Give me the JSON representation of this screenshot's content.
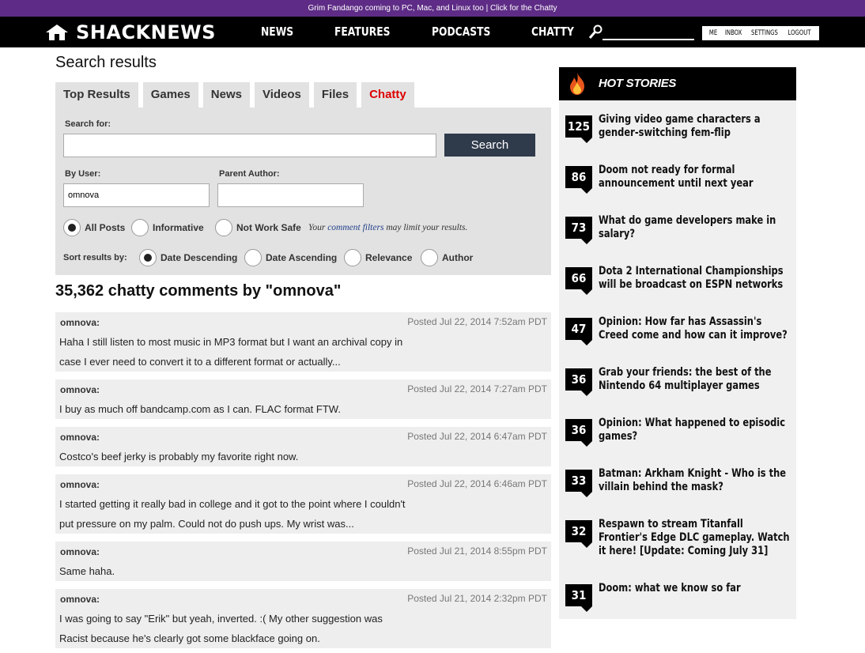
{
  "banner": {
    "text": "Grim Fandango coming to PC, Mac, and Linux too",
    "link": "Click for the Chatty"
  },
  "brand": {
    "name": "SHACKNEWS"
  },
  "nav": [
    "NEWS",
    "FEATURES",
    "PODCASTS",
    "CHATTY"
  ],
  "user_menu": [
    "ME",
    "INBOX",
    "SETTINGS",
    "LOGOUT"
  ],
  "page_title": "Search results",
  "tabs": [
    "Top Results",
    "Games",
    "News",
    "Videos",
    "Files",
    "Chatty"
  ],
  "active_tab": "Chatty",
  "search": {
    "search_for_label": "Search for:",
    "search_for_value": "",
    "button": "Search",
    "by_user_label": "By User:",
    "by_user_value": "omnova",
    "parent_author_label": "Parent Author:",
    "parent_author_value": "",
    "filters": [
      "All Posts",
      "Informative",
      "Not Work Safe"
    ],
    "filter_selected": "All Posts",
    "note_before": "Your",
    "note_link": "comment filters",
    "note_after": "may limit your results.",
    "sort_label": "Sort results by:",
    "sort_options": [
      "Date Descending",
      "Date Ascending",
      "Relevance",
      "Author"
    ],
    "sort_selected": "Date Descending"
  },
  "results_heading": "35,362 chatty comments by \"omnova\"",
  "results": [
    {
      "author": "omnova:",
      "date": "Posted Jul 22, 2014 7:52am PDT",
      "body": "Haha I still listen to most music in MP3 format but I want an archival copy in case I ever need to convert it to a different format or actually..."
    },
    {
      "author": "omnova:",
      "date": "Posted Jul 22, 2014 7:27am PDT",
      "body": "I buy as much off bandcamp.com as I can. FLAC format FTW."
    },
    {
      "author": "omnova:",
      "date": "Posted Jul 22, 2014 6:47am PDT",
      "body": "Costco's beef jerky is probably my favorite right now."
    },
    {
      "author": "omnova:",
      "date": "Posted Jul 22, 2014 6:46am PDT",
      "body": "I started getting it really bad in college and it got to the point where I couldn't put pressure on my palm. Could not do push ups. My wrist was..."
    },
    {
      "author": "omnova:",
      "date": "Posted Jul 21, 2014 8:55pm PDT",
      "body": "Same haha."
    },
    {
      "author": "omnova:",
      "date": "Posted Jul 21, 2014 2:32pm PDT",
      "body": "I was going to say \"Erik\" but yeah, inverted. :( My other suggestion was Racist because he's clearly got some blackface going on."
    }
  ],
  "hot_stories": {
    "title": "HOT STORIES",
    "items": [
      {
        "count": "125",
        "title": "Giving video game characters a gender-switching fem-flip"
      },
      {
        "count": "86",
        "title": "Doom not ready for formal announcement until next year"
      },
      {
        "count": "73",
        "title": "What do game developers make in salary?"
      },
      {
        "count": "66",
        "title": "Dota 2 International Championships will be broadcast on ESPN networks"
      },
      {
        "count": "47",
        "title": "Opinion: How far has Assassin's Creed come and how can it improve?"
      },
      {
        "count": "36",
        "title": "Grab your friends: the best of the Nintendo 64 multiplayer games"
      },
      {
        "count": "36",
        "title": "Opinion: What happened to episodic games?"
      },
      {
        "count": "33",
        "title": "Batman: Arkham Knight - Who is the villain behind the mask?"
      },
      {
        "count": "32",
        "title": "Respawn to stream Titanfall Frontier's Edge DLC gameplay. Watch it here! [Update: Coming July 31]"
      },
      {
        "count": "31",
        "title": "Doom: what we know so far"
      }
    ]
  }
}
